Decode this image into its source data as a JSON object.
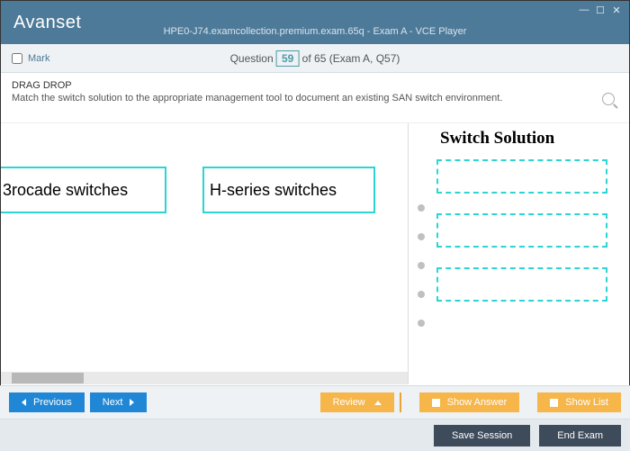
{
  "window": {
    "logo_html": "Avanset",
    "title": "HPE0-J74.examcollection.premium.exam.65q - Exam A - VCE Player"
  },
  "qbar": {
    "mark_label": "Mark",
    "q_word": "Question",
    "q_current": "59",
    "q_rest": " of 65 (Exam A, Q57)"
  },
  "instruction": {
    "title": "DRAG DROP",
    "body": "Match the switch solution to the appropriate management tool to document an existing SAN switch environment."
  },
  "content": {
    "right_heading": "Switch Solution",
    "drag_items": [
      "3rocade switches",
      "H-series switches"
    ]
  },
  "footer": {
    "previous": "Previous",
    "next": "Next",
    "review": "Review",
    "show_answer": "Show Answer",
    "show_list": "Show List",
    "save_session": "Save Session",
    "end_exam": "End Exam"
  }
}
